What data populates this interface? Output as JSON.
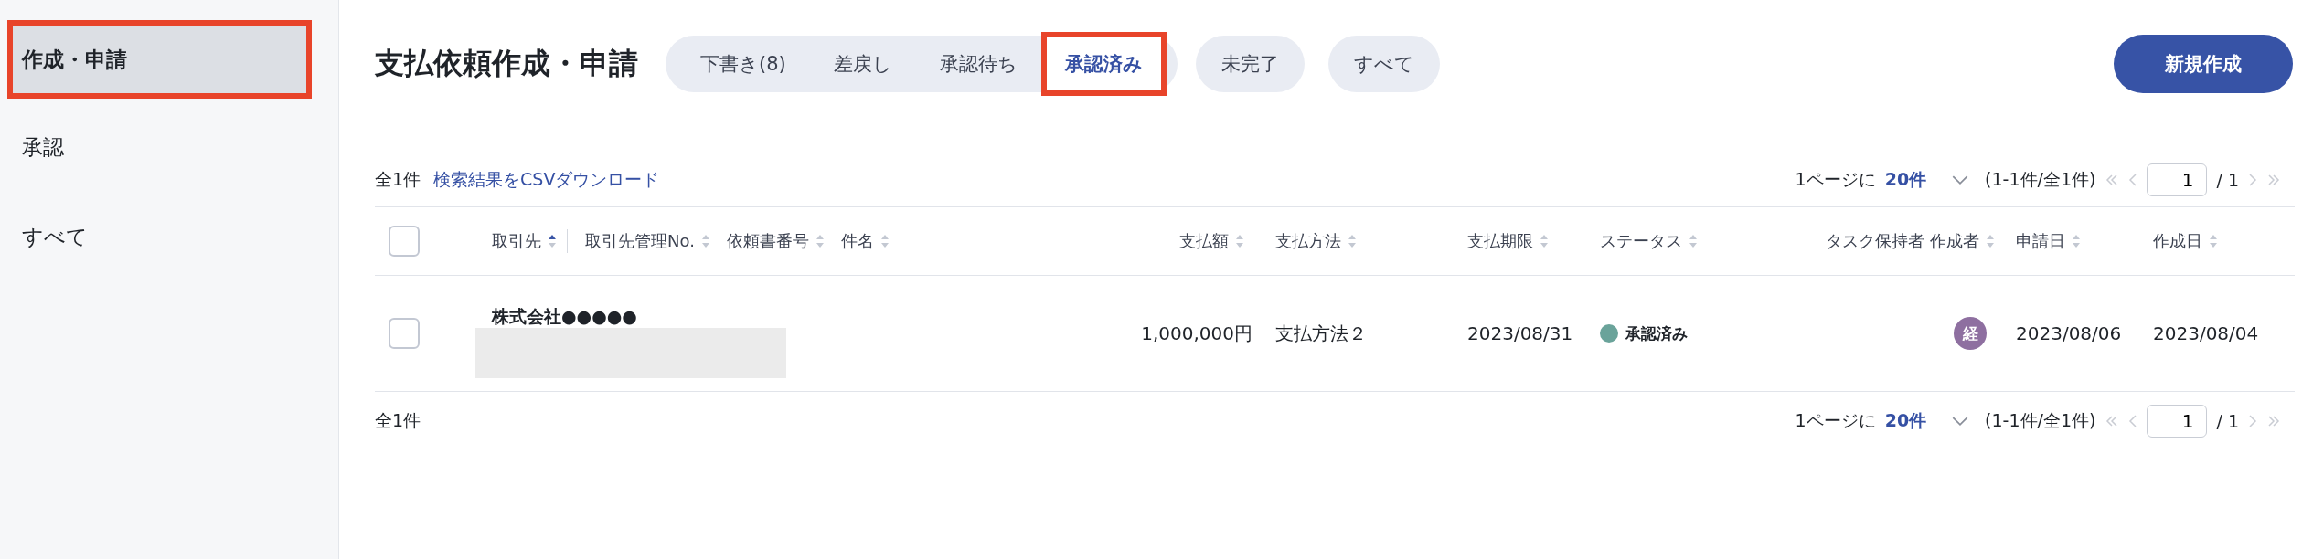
{
  "sidebar": {
    "items": [
      {
        "label": "作成・申請",
        "selected": true,
        "highlighted": true
      },
      {
        "label": "承認",
        "selected": false,
        "highlighted": false
      },
      {
        "label": "すべて",
        "selected": false,
        "highlighted": false
      }
    ]
  },
  "header": {
    "title": "支払依頼作成・申請",
    "tabs": [
      {
        "label": "下書き(8)",
        "kind": "grouped",
        "selected": false,
        "highlighted": false
      },
      {
        "label": "差戻し",
        "kind": "grouped",
        "selected": false,
        "highlighted": false
      },
      {
        "label": "承認待ち",
        "kind": "grouped",
        "selected": false,
        "highlighted": false
      },
      {
        "label": "承認済み",
        "kind": "grouped",
        "selected": true,
        "highlighted": true
      },
      {
        "label": "未完了",
        "kind": "single",
        "selected": false,
        "highlighted": false
      },
      {
        "label": "すべて",
        "kind": "single",
        "selected": false,
        "highlighted": false
      }
    ],
    "new_button": "新規作成"
  },
  "toolbar": {
    "count": "全1件",
    "csv_link": "検索結果をCSVダウンロード",
    "pagination": {
      "per_page_label": "1ページに",
      "per_page": "20件",
      "range": "(1-1件/全1件)",
      "page": "1",
      "total_pages": "/ 1",
      "prev_disabled": true,
      "next_disabled": true
    }
  },
  "table": {
    "select_all_checked": false,
    "columns": [
      {
        "label": "取引先",
        "sortable": true,
        "sorted": true
      },
      {
        "label": "取引先管理No.",
        "sortable": true,
        "sorted": false
      },
      {
        "label": "依頼書番号",
        "sortable": true,
        "sorted": false
      },
      {
        "label": "件名",
        "sortable": true,
        "sorted": false
      },
      {
        "label": "支払額",
        "sortable": true,
        "sorted": false
      },
      {
        "label": "支払方法",
        "sortable": true,
        "sorted": false
      },
      {
        "label": "支払期限",
        "sortable": true,
        "sorted": false
      },
      {
        "label": "ステータス",
        "sortable": true,
        "sorted": false
      },
      {
        "label": "タスク保持者",
        "sortable": false,
        "sorted": false
      },
      {
        "label": "作成者",
        "sortable": true,
        "sorted": false
      },
      {
        "label": "申請日",
        "sortable": true,
        "sorted": false
      },
      {
        "label": "作成日",
        "sortable": true,
        "sorted": false
      }
    ],
    "rows": [
      {
        "checked": false,
        "vendor": "株式会社●●●●●",
        "amount": "1,000,000円",
        "method": "支払方法２",
        "due": "2023/08/31",
        "status": {
          "label": "承認済み",
          "color": "#6aa39a"
        },
        "creator": {
          "initial": "経",
          "color": "#8e6fa0"
        },
        "applied": "2023/08/06",
        "created": "2023/08/04"
      }
    ]
  },
  "footer": {
    "count": "全1件",
    "pagination": {
      "per_page_label": "1ページに",
      "per_page": "20件",
      "range": "(1-1件/全1件)",
      "page": "1",
      "total_pages": "/ 1",
      "prev_disabled": true,
      "next_disabled": true
    }
  }
}
